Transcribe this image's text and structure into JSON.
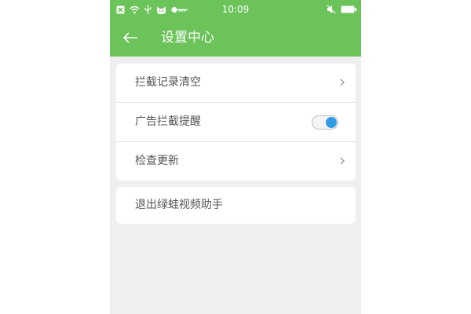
{
  "status_bar": {
    "time": "10:09",
    "left_icons": [
      "close-box-icon",
      "wifi-icon",
      "usb-icon",
      "cat-icon",
      "key-icon"
    ],
    "right_icons": [
      "mute-icon",
      "battery-icon"
    ]
  },
  "app_bar": {
    "title": "设置中心",
    "back_icon": "arrow-left-icon"
  },
  "settings": {
    "items": [
      {
        "label": "拦截记录清空",
        "control": "chevron"
      },
      {
        "label": "广告拦截提醒",
        "control": "toggle",
        "toggle_on": true
      },
      {
        "label": "检查更新",
        "control": "chevron"
      }
    ],
    "exit_label": "退出绿蛙视频助手"
  },
  "colors": {
    "primary": "#6bc35a",
    "toggle_knob": "#2f9be3",
    "background": "#efefef"
  }
}
